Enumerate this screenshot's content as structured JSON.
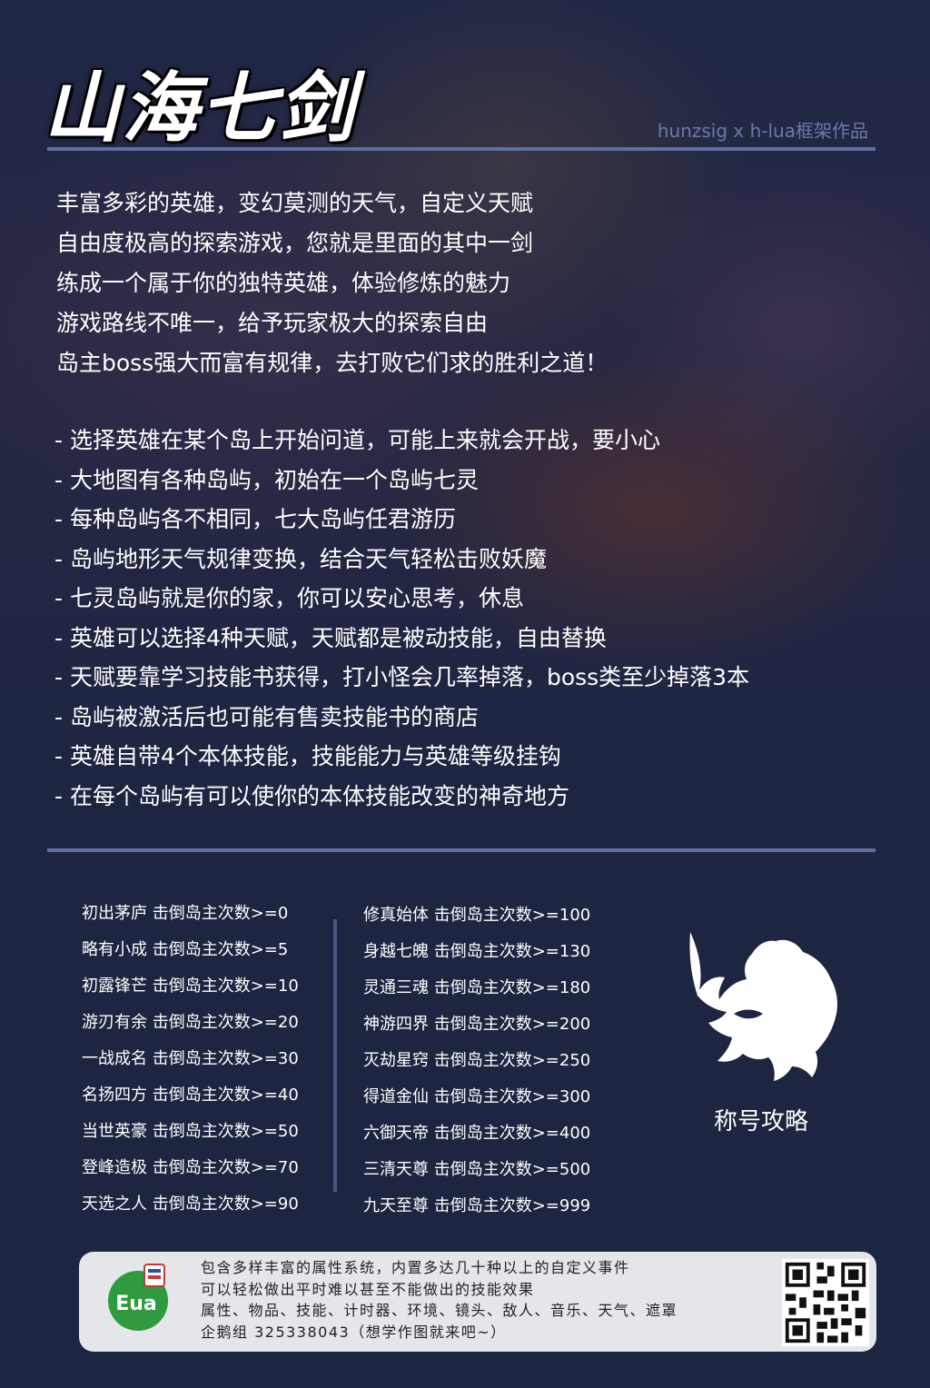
{
  "header": {
    "title": "山海七剑",
    "credit": "hunzsig x h-lua框架作品"
  },
  "intro": [
    "丰富多彩的英雄，变幻莫测的天气，自定义天赋",
    "自由度极高的探索游戏，您就是里面的其中一剑",
    "练成一个属于你的独特英雄，体验修炼的魅力",
    "游戏路线不唯一，给予玩家极大的探索自由",
    "岛主boss强大而富有规律，去打败它们求的胜利之道！"
  ],
  "features": [
    "- 选择英雄在某个岛上开始问道，可能上来就会开战，要小心",
    "- 大地图有各种岛屿，初始在一个岛屿七灵",
    "- 每种岛屿各不相同，七大岛屿任君游历",
    "- 岛屿地形天气规律变换，结合天气轻松击败妖魔",
    "- 七灵岛屿就是你的家，你可以安心思考，休息",
    "- 英雄可以选择4种天赋，天赋都是被动技能，自由替换",
    "- 天赋要靠学习技能书获得，打小怪会几率掉落，boss类至少掉落3本",
    "- 岛屿被激活后也可能有售卖技能书的商店",
    "- 英雄自带4个本体技能，技能能力与英雄等级挂钩",
    "- 在每个岛屿有可以使你的本体技能改变的神奇地方"
  ],
  "titles_left": [
    "初出茅庐 击倒岛主次数>=0",
    "略有小成 击倒岛主次数>=5",
    "初露锋芒 击倒岛主次数>=10",
    "游刃有余 击倒岛主次数>=20",
    "一战成名 击倒岛主次数>=30",
    "名扬四方 击倒岛主次数>=40",
    "当世英豪 击倒岛主次数>=50",
    "登峰造极 击倒岛主次数>=70",
    "天选之人 击倒岛主次数>=90"
  ],
  "titles_right": [
    "修真始体 击倒岛主次数>=100",
    "身越七魄 击倒岛主次数>=130",
    "灵通三魂 击倒岛主次数>=180",
    "神游四界 击倒岛主次数>=200",
    "灭劫星窍 击倒岛主次数>=250",
    "得道金仙 击倒岛主次数>=300",
    "六御天帝 击倒岛主次数>=400",
    "三清天尊 击倒岛主次数>=500",
    "九天至尊 击倒岛主次数>=999"
  ],
  "guide_label": "称号攻略",
  "footer": {
    "lines": [
      "包含多样丰富的属性系统，内置多达几十种以上的自定义事件",
      "可以轻松做出平时难以甚至不能做出的技能效果",
      "属性、物品、技能、计时器、环境、镜头、敌人、音乐、天气、遮罩",
      "企鹅组 325338043（想学作图就来吧~）"
    ],
    "logo_text": "Eua"
  },
  "colors": {
    "background": "#1d2541",
    "rule": "#5f6f9f",
    "credit": "#6b7aa8",
    "footer_bg": "#e4e6ea",
    "logo_green": "#2f9a3e"
  }
}
